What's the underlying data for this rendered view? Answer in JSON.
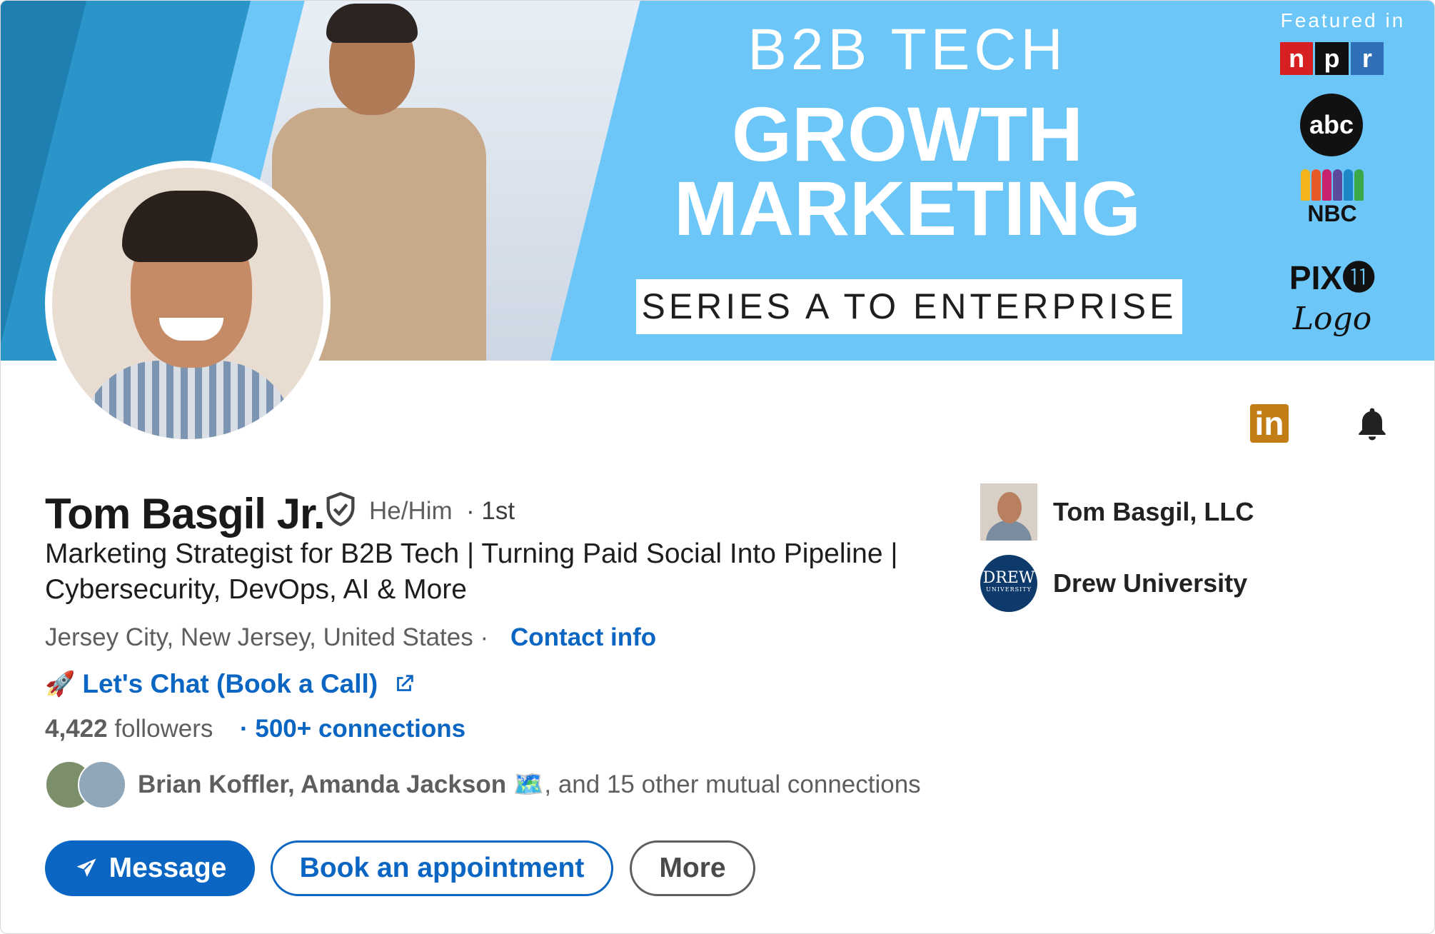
{
  "banner": {
    "line1": "B2B TECH",
    "line2": "GROWTH",
    "line3": "MARKETING",
    "series": "SERIES A TO ENTERPRISE",
    "featured_title": "Featured in",
    "npr": [
      "n",
      "p",
      "r"
    ],
    "abc": "abc",
    "nbc": "NBC",
    "pix": "PIX⓫",
    "logo_sig": "Logo"
  },
  "profile": {
    "name": "Tom Basgil Jr.",
    "pronouns": "He/Him",
    "degree": "· 1st",
    "headline": "Marketing Strategist for B2B Tech | Turning Paid Social Into Pipeline | Cybersecurity, DevOps, AI & More",
    "location": "Jersey City, New Jersey, United States ·",
    "contact_info": "Contact info",
    "book_link": "Let's Chat (Book a Call)",
    "followers_count": "4,422",
    "followers_label": "followers",
    "connections": "· 500+ connections",
    "mutual_names": "Brian Koffler, Amanda Jackson 🗺️",
    "mutual_rest": ", and 15 other mutual connections"
  },
  "actions": {
    "message": "Message",
    "book": "Book an appointment",
    "more": "More"
  },
  "experience": [
    {
      "label": "Tom Basgil, LLC"
    },
    {
      "label": "Drew University",
      "logo_text": "DREW",
      "logo_sub": "UNIVERSITY"
    }
  ],
  "colors": {
    "accent": "#0a66c2",
    "banner_bg": "#6cc6f7",
    "linkedin_badge": "#c37d16"
  },
  "icons": [
    "verified-shield-icon",
    "linkedin-icon",
    "bell-icon",
    "external-link-icon",
    "send-icon",
    "rocket-icon"
  ]
}
